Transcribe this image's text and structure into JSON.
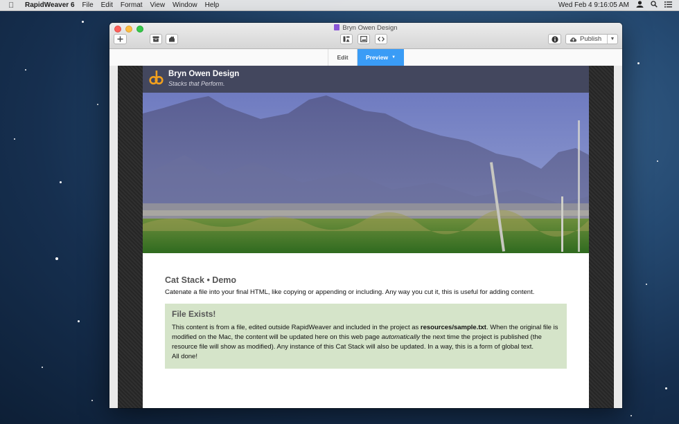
{
  "menubar": {
    "app_name": "RapidWeaver 6",
    "items": [
      "File",
      "Edit",
      "Format",
      "View",
      "Window",
      "Help"
    ],
    "clock": "Wed Feb 4  9:16:05 AM"
  },
  "window": {
    "title": "Bryn Owen Design",
    "publish_label": "Publish",
    "tabs": {
      "edit": "Edit",
      "preview": "Preview"
    }
  },
  "site": {
    "title": "Bryn Owen Design",
    "tagline": "Stacks that Perform.",
    "heading": "Cat Stack • Demo",
    "intro": "Catenate a file into your final HTML, like copying or appending or including. Any way you cut it, this is useful for adding content.",
    "box": {
      "title": "File Exists!",
      "text_1": "This content is from a file, edited outside RapidWeaver and included in the project as ",
      "file_path": "resources/sample.txt",
      "text_2": ". When the original file is modified on the Mac, the content will be updated here on this web page ",
      "emphasis": "automatically",
      "text_3": " the next time the project is published (the resource file will show as modified). Any instance of this Cat Stack will also be updated. In a way, this is a form of global text.",
      "done": "All done!"
    }
  },
  "colors": {
    "accent": "#3a9cf6",
    "header_bg": "#43475e",
    "box_bg": "#d5e4c9",
    "logo_orange": "#f2a01e"
  }
}
